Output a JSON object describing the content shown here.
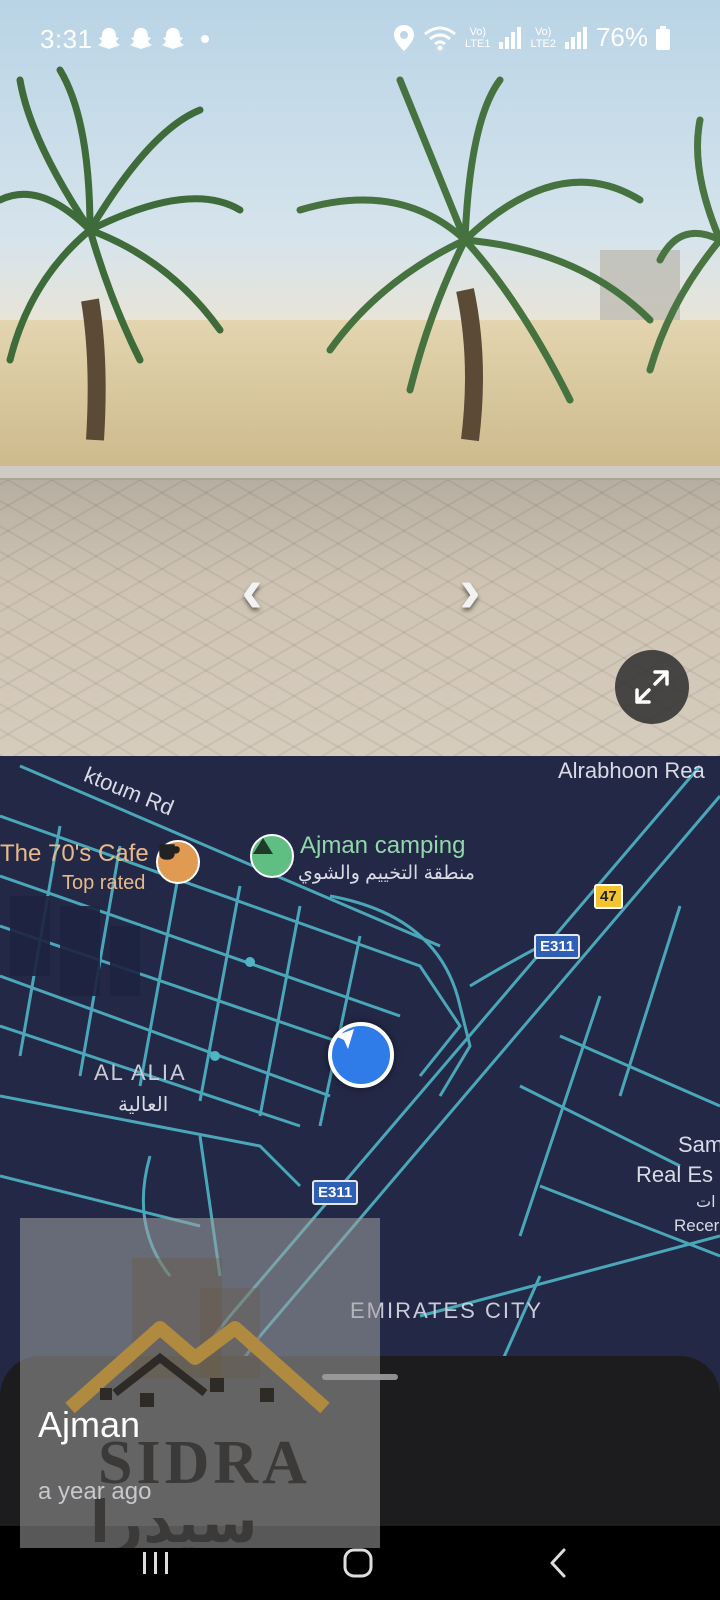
{
  "status_bar": {
    "time": "3:31",
    "battery_percent": "76%",
    "network_1": "LTE1",
    "network_2": "LTE2",
    "icons": [
      "snapchat-icon",
      "snapchat-icon",
      "snapchat-icon",
      "dot-icon",
      "location-icon",
      "wifi-icon",
      "signal-icon",
      "signal-icon",
      "battery-icon"
    ]
  },
  "street_view": {
    "controls": [
      "left-arrow-icon",
      "right-arrow-icon",
      "expand-icon"
    ]
  },
  "map": {
    "labels": {
      "street_maktoum": "ktoum Rd",
      "alrabhoon": "Alrabhoon Rea",
      "cafe_name": "The 70's Cafe",
      "cafe_badge": "Top rated",
      "camping_name": "Ajman camping",
      "camping_arabic": "منطقة التخييم والشوي",
      "al_alia": "AL ALIA",
      "al_alia_arabic": "العالية",
      "sam_line1": "Sam",
      "sam_line2": "Real Es",
      "sam_line3": "ات",
      "sam_line4": "Recer",
      "emirates_city": "EMIRATES CITY"
    },
    "shields": {
      "route_47": "47",
      "e311_top": "E311",
      "e311_bottom": "E311"
    },
    "colors": {
      "background": "#232846",
      "road": "#4fb5c6",
      "location": "#2f7be8"
    }
  },
  "watermark": {
    "latin": "SIDRA",
    "arabic": "سيدرا"
  },
  "bottom_sheet": {
    "title": "Ajman",
    "subtitle": "a year ago"
  },
  "navigation_bar": {
    "buttons": [
      "recents-icon",
      "home-icon",
      "back-icon"
    ]
  }
}
